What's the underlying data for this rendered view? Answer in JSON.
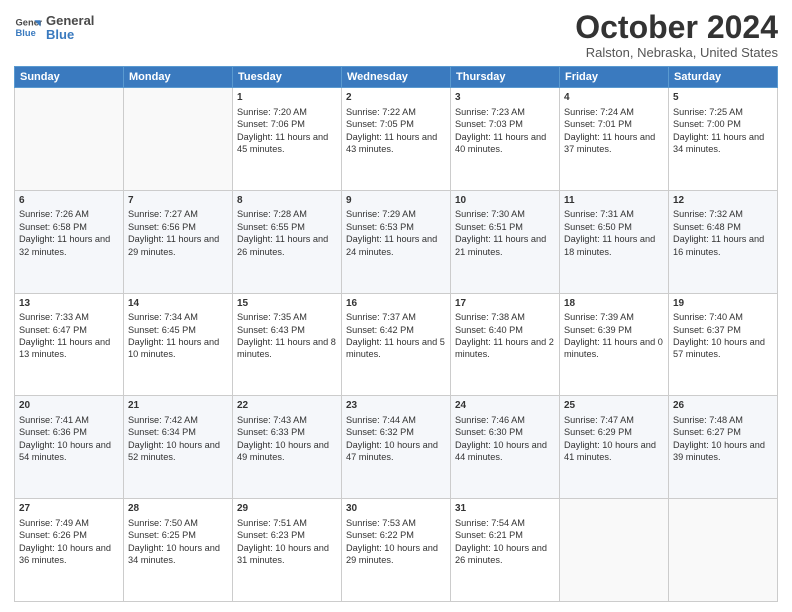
{
  "header": {
    "logo_line1": "General",
    "logo_line2": "Blue",
    "month": "October 2024",
    "location": "Ralston, Nebraska, United States"
  },
  "days_of_week": [
    "Sunday",
    "Monday",
    "Tuesday",
    "Wednesday",
    "Thursday",
    "Friday",
    "Saturday"
  ],
  "weeks": [
    [
      {
        "day": "",
        "sunrise": "",
        "sunset": "",
        "daylight": ""
      },
      {
        "day": "",
        "sunrise": "",
        "sunset": "",
        "daylight": ""
      },
      {
        "day": "1",
        "sunrise": "Sunrise: 7:20 AM",
        "sunset": "Sunset: 7:06 PM",
        "daylight": "Daylight: 11 hours and 45 minutes."
      },
      {
        "day": "2",
        "sunrise": "Sunrise: 7:22 AM",
        "sunset": "Sunset: 7:05 PM",
        "daylight": "Daylight: 11 hours and 43 minutes."
      },
      {
        "day": "3",
        "sunrise": "Sunrise: 7:23 AM",
        "sunset": "Sunset: 7:03 PM",
        "daylight": "Daylight: 11 hours and 40 minutes."
      },
      {
        "day": "4",
        "sunrise": "Sunrise: 7:24 AM",
        "sunset": "Sunset: 7:01 PM",
        "daylight": "Daylight: 11 hours and 37 minutes."
      },
      {
        "day": "5",
        "sunrise": "Sunrise: 7:25 AM",
        "sunset": "Sunset: 7:00 PM",
        "daylight": "Daylight: 11 hours and 34 minutes."
      }
    ],
    [
      {
        "day": "6",
        "sunrise": "Sunrise: 7:26 AM",
        "sunset": "Sunset: 6:58 PM",
        "daylight": "Daylight: 11 hours and 32 minutes."
      },
      {
        "day": "7",
        "sunrise": "Sunrise: 7:27 AM",
        "sunset": "Sunset: 6:56 PM",
        "daylight": "Daylight: 11 hours and 29 minutes."
      },
      {
        "day": "8",
        "sunrise": "Sunrise: 7:28 AM",
        "sunset": "Sunset: 6:55 PM",
        "daylight": "Daylight: 11 hours and 26 minutes."
      },
      {
        "day": "9",
        "sunrise": "Sunrise: 7:29 AM",
        "sunset": "Sunset: 6:53 PM",
        "daylight": "Daylight: 11 hours and 24 minutes."
      },
      {
        "day": "10",
        "sunrise": "Sunrise: 7:30 AM",
        "sunset": "Sunset: 6:51 PM",
        "daylight": "Daylight: 11 hours and 21 minutes."
      },
      {
        "day": "11",
        "sunrise": "Sunrise: 7:31 AM",
        "sunset": "Sunset: 6:50 PM",
        "daylight": "Daylight: 11 hours and 18 minutes."
      },
      {
        "day": "12",
        "sunrise": "Sunrise: 7:32 AM",
        "sunset": "Sunset: 6:48 PM",
        "daylight": "Daylight: 11 hours and 16 minutes."
      }
    ],
    [
      {
        "day": "13",
        "sunrise": "Sunrise: 7:33 AM",
        "sunset": "Sunset: 6:47 PM",
        "daylight": "Daylight: 11 hours and 13 minutes."
      },
      {
        "day": "14",
        "sunrise": "Sunrise: 7:34 AM",
        "sunset": "Sunset: 6:45 PM",
        "daylight": "Daylight: 11 hours and 10 minutes."
      },
      {
        "day": "15",
        "sunrise": "Sunrise: 7:35 AM",
        "sunset": "Sunset: 6:43 PM",
        "daylight": "Daylight: 11 hours and 8 minutes."
      },
      {
        "day": "16",
        "sunrise": "Sunrise: 7:37 AM",
        "sunset": "Sunset: 6:42 PM",
        "daylight": "Daylight: 11 hours and 5 minutes."
      },
      {
        "day": "17",
        "sunrise": "Sunrise: 7:38 AM",
        "sunset": "Sunset: 6:40 PM",
        "daylight": "Daylight: 11 hours and 2 minutes."
      },
      {
        "day": "18",
        "sunrise": "Sunrise: 7:39 AM",
        "sunset": "Sunset: 6:39 PM",
        "daylight": "Daylight: 11 hours and 0 minutes."
      },
      {
        "day": "19",
        "sunrise": "Sunrise: 7:40 AM",
        "sunset": "Sunset: 6:37 PM",
        "daylight": "Daylight: 10 hours and 57 minutes."
      }
    ],
    [
      {
        "day": "20",
        "sunrise": "Sunrise: 7:41 AM",
        "sunset": "Sunset: 6:36 PM",
        "daylight": "Daylight: 10 hours and 54 minutes."
      },
      {
        "day": "21",
        "sunrise": "Sunrise: 7:42 AM",
        "sunset": "Sunset: 6:34 PM",
        "daylight": "Daylight: 10 hours and 52 minutes."
      },
      {
        "day": "22",
        "sunrise": "Sunrise: 7:43 AM",
        "sunset": "Sunset: 6:33 PM",
        "daylight": "Daylight: 10 hours and 49 minutes."
      },
      {
        "day": "23",
        "sunrise": "Sunrise: 7:44 AM",
        "sunset": "Sunset: 6:32 PM",
        "daylight": "Daylight: 10 hours and 47 minutes."
      },
      {
        "day": "24",
        "sunrise": "Sunrise: 7:46 AM",
        "sunset": "Sunset: 6:30 PM",
        "daylight": "Daylight: 10 hours and 44 minutes."
      },
      {
        "day": "25",
        "sunrise": "Sunrise: 7:47 AM",
        "sunset": "Sunset: 6:29 PM",
        "daylight": "Daylight: 10 hours and 41 minutes."
      },
      {
        "day": "26",
        "sunrise": "Sunrise: 7:48 AM",
        "sunset": "Sunset: 6:27 PM",
        "daylight": "Daylight: 10 hours and 39 minutes."
      }
    ],
    [
      {
        "day": "27",
        "sunrise": "Sunrise: 7:49 AM",
        "sunset": "Sunset: 6:26 PM",
        "daylight": "Daylight: 10 hours and 36 minutes."
      },
      {
        "day": "28",
        "sunrise": "Sunrise: 7:50 AM",
        "sunset": "Sunset: 6:25 PM",
        "daylight": "Daylight: 10 hours and 34 minutes."
      },
      {
        "day": "29",
        "sunrise": "Sunrise: 7:51 AM",
        "sunset": "Sunset: 6:23 PM",
        "daylight": "Daylight: 10 hours and 31 minutes."
      },
      {
        "day": "30",
        "sunrise": "Sunrise: 7:53 AM",
        "sunset": "Sunset: 6:22 PM",
        "daylight": "Daylight: 10 hours and 29 minutes."
      },
      {
        "day": "31",
        "sunrise": "Sunrise: 7:54 AM",
        "sunset": "Sunset: 6:21 PM",
        "daylight": "Daylight: 10 hours and 26 minutes."
      },
      {
        "day": "",
        "sunrise": "",
        "sunset": "",
        "daylight": ""
      },
      {
        "day": "",
        "sunrise": "",
        "sunset": "",
        "daylight": ""
      }
    ]
  ]
}
